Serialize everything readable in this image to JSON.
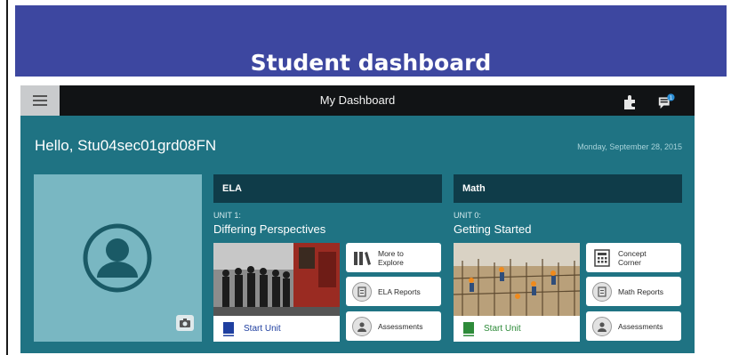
{
  "slide": {
    "title": "Student dashboard"
  },
  "topbar": {
    "menu_icon": "hamburger-menu-icon",
    "title": "My Dashboard",
    "icons": [
      "puzzle-icon",
      "messages-icon"
    ],
    "notification_count": "1"
  },
  "greeting": "Hello, Stu04sec01grd08FN",
  "date": "Monday, September 28, 2015",
  "profile": {
    "avatar_icon": "user-avatar-icon",
    "camera_icon": "camera-icon"
  },
  "colors": {
    "header_band": "#3d47a0",
    "app_background": "#1f7383",
    "subject_header": "#0f3c49",
    "avatar_panel": "#79b7c2",
    "ela_accent": "#1f3fa0",
    "math_accent": "#2e8b3a"
  },
  "subjects": [
    {
      "name": "ELA",
      "unit_code": "UNIT 1:",
      "unit_name": "Differing Perspectives",
      "start_label": "Start Unit",
      "buttons": [
        {
          "label_line1": "More to",
          "label_line2": "Explore",
          "icon": "library-books-icon"
        },
        {
          "label": "ELA Reports",
          "icon": "reports-icon"
        },
        {
          "label": "Assessments",
          "icon": "assessments-icon"
        }
      ]
    },
    {
      "name": "Math",
      "unit_code": "UNIT 0:",
      "unit_name": "Getting Started",
      "start_label": "Start Unit",
      "buttons": [
        {
          "label_line1": "Concept",
          "label_line2": "Corner",
          "icon": "calculator-icon"
        },
        {
          "label": "Math Reports",
          "icon": "reports-icon"
        },
        {
          "label": "Assessments",
          "icon": "assessments-icon"
        }
      ]
    }
  ]
}
